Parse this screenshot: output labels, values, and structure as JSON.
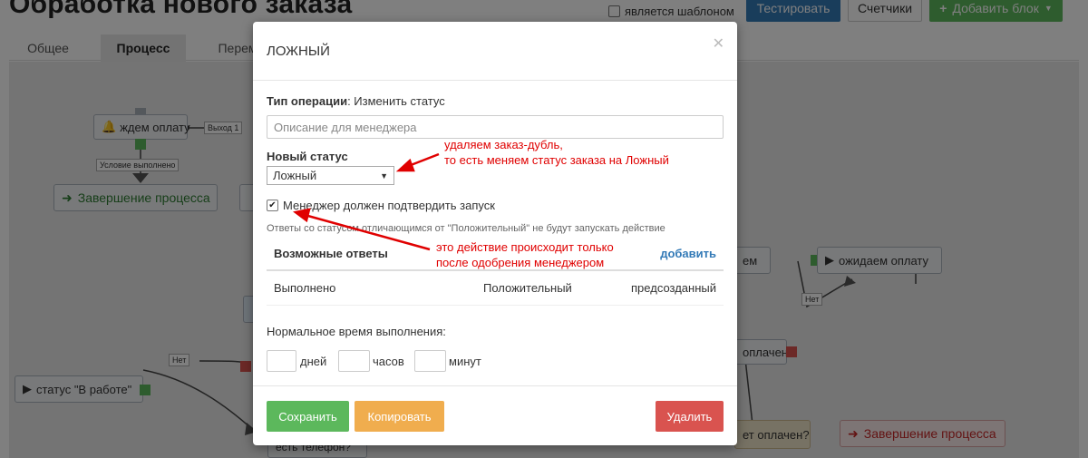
{
  "page": {
    "title": "Обработка нового заказа",
    "template_label": "является шаблоном",
    "buttons": {
      "test": "Тестировать",
      "counters": "Счетчики",
      "add_block": "Добавить блок"
    },
    "tabs": [
      "Общее",
      "Процесс",
      "Перем"
    ]
  },
  "canvas": {
    "nodes": {
      "wait_payment": "ждем оплату",
      "finish_process_left": "Завершение процесса",
      "status_in_work": "статус \"В работе\"",
      "waiting_payment_right": "ожидаем оплату",
      "em_fragment": "ем",
      "paid_fragment": "оплачен?",
      "paid_question": "ет оплачен?",
      "finish_process_right": "Завершение процесса",
      "phone_fragment": "есть телефон?"
    },
    "labels": {
      "exit1": "Выход 1",
      "condition_done": "Условие выполнено",
      "no_left": "Нет",
      "no_right": "Нет"
    }
  },
  "modal": {
    "title": "ЛОЖНЫЙ",
    "operation_type_label": "Тип операции",
    "operation_type_value": ": Изменить статус",
    "description_placeholder": "Описание для менеджера",
    "new_status_label": "Новый статус",
    "new_status_value": "Ложный",
    "confirm_label": "Менеджер должен подтвердить запуск",
    "confirm_checked": true,
    "hint": "Ответы со статусом отличающимся от \"Положительный\" не будут запускать действие",
    "answers_header": "Возможные ответы",
    "add_label": "добавить",
    "answers": [
      {
        "name": "Выполнено",
        "type": "Положительный",
        "origin": "предсозданный"
      }
    ],
    "exec_time_label": "Нормальное время выполнения:",
    "units": {
      "days": "дней",
      "hours": "часов",
      "minutes": "минут"
    },
    "buttons": {
      "save": "Сохранить",
      "copy": "Копировать",
      "delete": "Удалить"
    }
  },
  "annotations": {
    "first": [
      "удаляем заказ-дубль,",
      "то есть меняем статус заказа на Ложный"
    ],
    "second": [
      "это действие происходит только",
      "после одобрения менеджером"
    ],
    "color": "#e00000"
  }
}
